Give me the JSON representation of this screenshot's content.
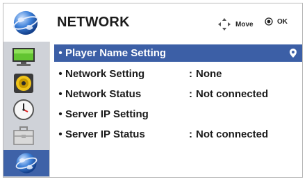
{
  "header": {
    "title": "NETWORK",
    "move_label": "Move",
    "ok_label": "OK",
    "icon": "globe-icon"
  },
  "sidebar": {
    "items": [
      {
        "name": "monitor-icon"
      },
      {
        "name": "speaker-icon"
      },
      {
        "name": "clock-icon"
      },
      {
        "name": "toolbox-icon"
      },
      {
        "name": "globe-icon"
      }
    ]
  },
  "menu": {
    "rows": [
      {
        "bullet": "•",
        "label": "Player Name Setting",
        "sep": "",
        "value": ""
      },
      {
        "bullet": "•",
        "label": "Network Setting",
        "sep": ":",
        "value": "None"
      },
      {
        "bullet": "•",
        "label": "Network Status",
        "sep": ":",
        "value": "Not connected"
      },
      {
        "bullet": "•",
        "label": "Server IP Setting",
        "sep": "",
        "value": ""
      },
      {
        "bullet": "•",
        "label": "Server IP Status",
        "sep": ":",
        "value": "Not connected"
      }
    ]
  },
  "colors": {
    "highlight": "#3c5fa6",
    "sidebar": "#cfd2d8"
  }
}
